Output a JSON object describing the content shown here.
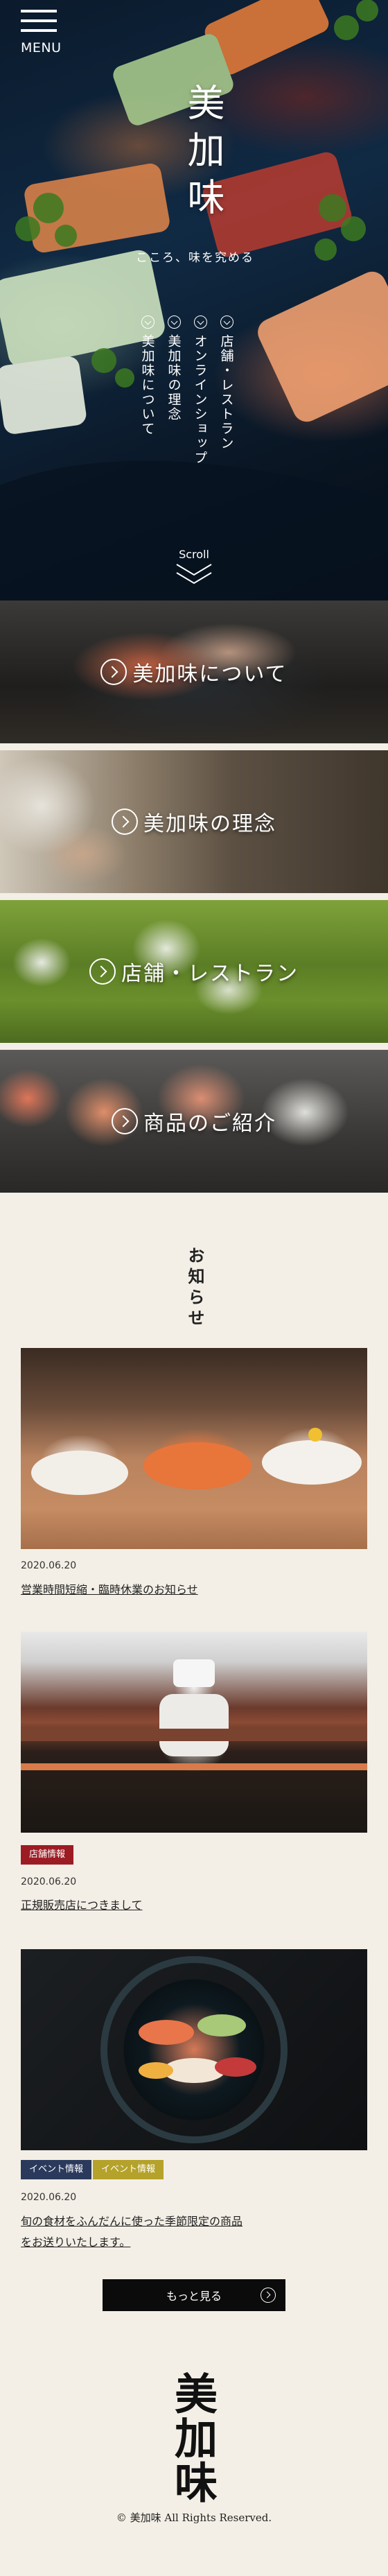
{
  "header": {
    "menu_label": "MENU"
  },
  "hero": {
    "logo": "美加味",
    "tagline": "こころ、味を究める",
    "nav": [
      {
        "label": "店舗・レストラン"
      },
      {
        "label": "オンラインショップ"
      },
      {
        "label": "美加味の理念"
      },
      {
        "label": "美加味について"
      }
    ],
    "scroll_label": "Scroll"
  },
  "banners": [
    {
      "label": "美加味について"
    },
    {
      "label": "美加味の理念"
    },
    {
      "label": "店舗・レストラン"
    },
    {
      "label": "商品のご紹介"
    }
  ],
  "news": {
    "title": "お知らせ",
    "items": [
      {
        "date": "2020.06.20",
        "title": "営業時間短縮・臨時休業のお知らせ",
        "tags": []
      },
      {
        "date": "2020.06.20",
        "title": "正規販売店につきまして",
        "tags": [
          "店舗情報"
        ]
      },
      {
        "date": "2020.06.20",
        "title_line1": "旬の食材をふんだんに使った季節限定の商品",
        "title_line2": "をお送りいたします。",
        "tags": [
          "イベント情報",
          "イベント情報"
        ]
      }
    ],
    "more_label": "もっと見る"
  },
  "footer": {
    "logo": "美加味",
    "copyright": "© 美加味 All Rights Reserved."
  },
  "colors": {
    "background": "#f3efe6",
    "tag_shop": "#9c1c24",
    "tag_event_primary": "#2b3a5c",
    "tag_event_secondary": "#b5a22a",
    "button": "#0b0b0b"
  }
}
